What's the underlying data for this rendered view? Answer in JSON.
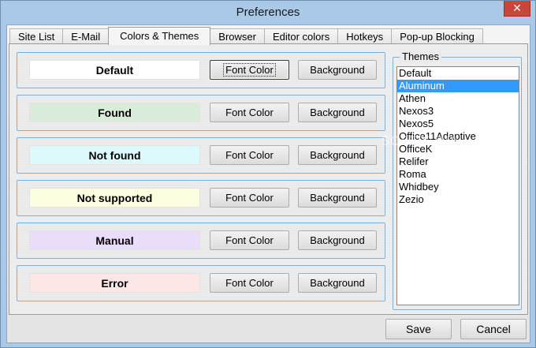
{
  "window": {
    "title": "Preferences",
    "close_glyph": "✕"
  },
  "tabs": [
    {
      "label": "Site List",
      "active": false
    },
    {
      "label": "E-Mail",
      "active": false
    },
    {
      "label": "Colors & Themes",
      "active": true
    },
    {
      "label": "Browser",
      "active": false
    },
    {
      "label": "Editor colors",
      "active": false
    },
    {
      "label": "Hotkeys",
      "active": false
    },
    {
      "label": "Pop-up Blocking",
      "active": false
    }
  ],
  "color_rows": [
    {
      "label": "Default",
      "swatch_color": "#ffffff",
      "font_color_label": "Font Color",
      "background_label": "Background"
    },
    {
      "label": "Found",
      "swatch_color": "#d9ecd9",
      "font_color_label": "Font Color",
      "background_label": "Background"
    },
    {
      "label": "Not found",
      "swatch_color": "#dcfafc",
      "font_color_label": "Font Color",
      "background_label": "Background"
    },
    {
      "label": "Not supported",
      "swatch_color": "#fdfde0",
      "font_color_label": "Font Color",
      "background_label": "Background"
    },
    {
      "label": "Manual",
      "swatch_color": "#eadcfb",
      "font_color_label": "Font Color",
      "background_label": "Background"
    },
    {
      "label": "Error",
      "swatch_color": "#fde6e6",
      "font_color_label": "Font Color",
      "background_label": "Background"
    }
  ],
  "themes": {
    "legend": "Themes",
    "items": [
      "Default",
      "Aluminum",
      "Athen",
      "Nexos3",
      "Nexos5",
      "Office11Adaptive",
      "OfficeK",
      "Relifer",
      "Roma",
      "Whidbey",
      "Zezio"
    ],
    "selected": "Aluminum"
  },
  "footer": {
    "save_label": "Save",
    "cancel_label": "Cancel"
  },
  "watermark": "SOFTPEDIA",
  "colors": {
    "selection": "#3399ff",
    "group_border": "#7fb0d8",
    "frame": "#a9c9e6"
  }
}
